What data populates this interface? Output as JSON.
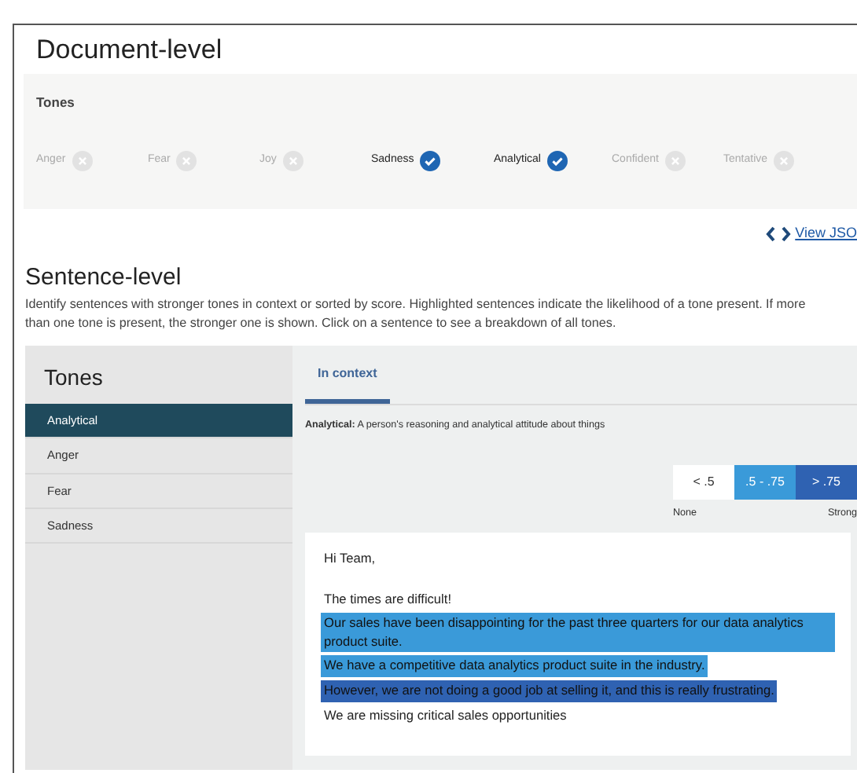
{
  "document_level": {
    "title": "Document-level",
    "panel_title": "Tones",
    "tones": [
      {
        "label": "Anger",
        "detected": false
      },
      {
        "label": "Fear",
        "detected": false
      },
      {
        "label": "Joy",
        "detected": false
      },
      {
        "label": "Sadness",
        "detected": true
      },
      {
        "label": "Analytical",
        "detected": true
      },
      {
        "label": "Confident",
        "detected": false
      },
      {
        "label": "Tentative",
        "detected": false
      }
    ]
  },
  "json_link": "View JSO",
  "sentence_level": {
    "title": "Sentence-level",
    "description": "Identify sentences with stronger tones in context or sorted by score. Highlighted sentences indicate the likelihood of a tone present. If more than one tone is present, the stronger one is shown. Click on a sentence to see a breakdown of all tones."
  },
  "sidebar": {
    "title": "Tones",
    "items": [
      {
        "label": "Analytical",
        "selected": true
      },
      {
        "label": "Anger",
        "selected": false
      },
      {
        "label": "Fear",
        "selected": false
      },
      {
        "label": "Sadness",
        "selected": false
      }
    ]
  },
  "tabs": [
    {
      "label": "In context",
      "selected": true
    }
  ],
  "definition": {
    "term": "Analytical:",
    "text": "A person's reasoning and analytical attitude about things"
  },
  "legend": {
    "bands": [
      {
        "label": "< .5",
        "color": "#ffffff"
      },
      {
        "label": ".5 - .75",
        "color": "#3a9ad9"
      },
      {
        "label": "> .75",
        "color": "#2f62b2"
      }
    ],
    "low_label": "None",
    "high_label": "Strong"
  },
  "sentences": [
    {
      "text": "Hi Team,"
    },
    {
      "text": "The times are difficult!"
    },
    {
      "text": "Our sales have been disappointing for the past three quarters for our data analytics product suite.",
      "color": "#3a9ad9"
    },
    {
      "text": "We have a competitive data analytics product suite in the industry.",
      "color": "#3a9ad9"
    },
    {
      "text": "However, we are not doing a good job at selling it, and this is really frustrating.",
      "color": "#2f62b2"
    },
    {
      "text": "We are missing critical sales opportunities"
    }
  ]
}
